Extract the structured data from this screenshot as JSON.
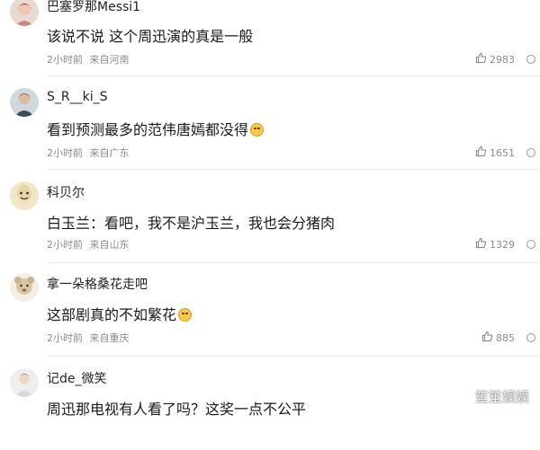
{
  "comments": [
    {
      "username": "巴塞罗那Messi1",
      "content": "该说不说 这个周迅演的真是一般",
      "time": "2小时前",
      "location": "来自河南",
      "likes": "2983"
    },
    {
      "username": "S_R__ki_S",
      "content": "看到预测最多的范伟唐嫣都没得",
      "emoji": "laughing-tears-emoji",
      "time": "2小时前",
      "location": "来自广东",
      "likes": "1651"
    },
    {
      "username": "科贝尔",
      "content": "白玉兰：看吧，我不是沪玉兰，我也会分猪肉",
      "time": "2小时前",
      "location": "来自山东",
      "likes": "1329"
    },
    {
      "username": "拿一朵格桑花走吧",
      "content": "这部剧真的不如繁花",
      "emoji": "smile-emoji",
      "time": "2小时前",
      "location": "来自重庆",
      "likes": "885"
    },
    {
      "username": "记de_微笑",
      "content": "周迅那电视有人看了吗？这奖一点不公平"
    }
  ],
  "watermark": "笙笙娱娱",
  "icons": {
    "like": "thumbs-up-icon",
    "more": "more-circle-icon",
    "watermark": "watermark-logo-icon"
  },
  "colors": {
    "text_primary": "#1a1a1a",
    "text_meta": "#8a8a8a",
    "divider": "#ececec"
  }
}
